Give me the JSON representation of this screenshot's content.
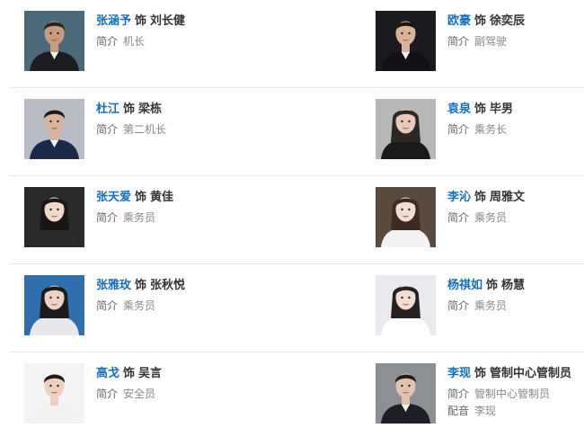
{
  "cast": [
    {
      "actor": "张涵予",
      "sep": "饰",
      "role": "刘长健",
      "info": [
        {
          "key": "简介",
          "value": "机长"
        }
      ],
      "photo": {
        "bg": "#4a6a7a",
        "skin": "#c79b7f",
        "hair": "#2a2420",
        "cloth": "#1c1c22"
      }
    },
    {
      "actor": "欧豪",
      "sep": "饰",
      "role": "徐奕辰",
      "info": [
        {
          "key": "简介",
          "value": "副驾驶"
        }
      ],
      "photo": {
        "bg": "#1a1a1f",
        "skin": "#d8b49a",
        "hair": "#18161a",
        "cloth": "#121216"
      }
    },
    {
      "actor": "杜江",
      "sep": "饰",
      "role": "梁栋",
      "info": [
        {
          "key": "简介",
          "value": "第二机长"
        }
      ],
      "photo": {
        "bg": "#b8bcc4",
        "skin": "#d9b39a",
        "hair": "#1e1a18",
        "cloth": "#1b2a4a"
      }
    },
    {
      "actor": "袁泉",
      "sep": "饰",
      "role": "毕男",
      "info": [
        {
          "key": "简介",
          "value": "乘务长"
        }
      ],
      "photo": {
        "bg": "#b7b7b7",
        "skin": "#e7cbb8",
        "hair": "#2c2624",
        "cloth": "#1a1a1a"
      }
    },
    {
      "actor": "张天爱",
      "sep": "饰",
      "role": "黄佳",
      "info": [
        {
          "key": "简介",
          "value": "乘务员"
        }
      ],
      "photo": {
        "bg": "#2a2a2a",
        "skin": "#f0d9cb",
        "hair": "#1a1616",
        "cloth": "#2b2b2b"
      }
    },
    {
      "actor": "李沁",
      "sep": "饰",
      "role": "周雅文",
      "info": [
        {
          "key": "简介",
          "value": "乘务员"
        }
      ],
      "photo": {
        "bg": "#5a4a3e",
        "skin": "#f3ddd0",
        "hair": "#3a2c24",
        "cloth": "#f2f2f2"
      }
    },
    {
      "actor": "张雅玫",
      "sep": "饰",
      "role": "张秋悦",
      "info": [
        {
          "key": "简介",
          "value": "乘务员"
        }
      ],
      "photo": {
        "bg": "#2f6fae",
        "skin": "#ecd2c2",
        "hair": "#1d1a1a",
        "cloth": "#e8e8ec"
      }
    },
    {
      "actor": "杨祺如",
      "sep": "饰",
      "role": "杨慧",
      "info": [
        {
          "key": "简介",
          "value": "乘务员"
        }
      ],
      "photo": {
        "bg": "#e9e9ee",
        "skin": "#f2ddd2",
        "hair": "#262020",
        "cloth": "#ffffff"
      }
    },
    {
      "actor": "高戈",
      "sep": "饰",
      "role": "吴言",
      "info": [
        {
          "key": "简介",
          "value": "安全员"
        }
      ],
      "photo": {
        "bg": "#f4f4f4",
        "skin": "#edd0bd",
        "hair": "#1e1a18",
        "cloth": "#f2f2f2"
      }
    },
    {
      "actor": "李现",
      "sep": "饰",
      "role": "管制中心管制员",
      "info": [
        {
          "key": "简介",
          "value": "管制中心管制员"
        },
        {
          "key": "配音",
          "value": "李现"
        }
      ],
      "photo": {
        "bg": "#8c8f94",
        "skin": "#e2c3ad",
        "hair": "#1f1b19",
        "cloth": "#1e1e24"
      }
    }
  ]
}
